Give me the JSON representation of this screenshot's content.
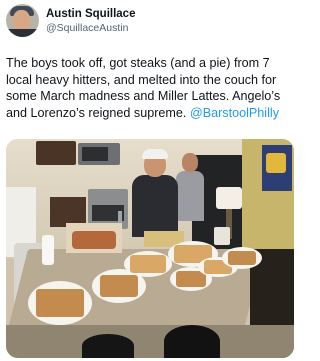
{
  "author": {
    "display_name": "Austin Squillace",
    "handle": "@SquillaceAustin"
  },
  "tweet": {
    "text": "The boys took off, got steaks (and a pie) from 7 local heavy hitters, and melted into the couch for some March madness and Miller Lattes. Angelo’s and Lorenzo’s reigned supreme. ",
    "mention": "@BarstoolPhilly"
  },
  "media": {
    "description_icon": "photo"
  },
  "colors": {
    "link": "#1d9bf0",
    "text": "#0f1419",
    "secondary": "#536471"
  }
}
